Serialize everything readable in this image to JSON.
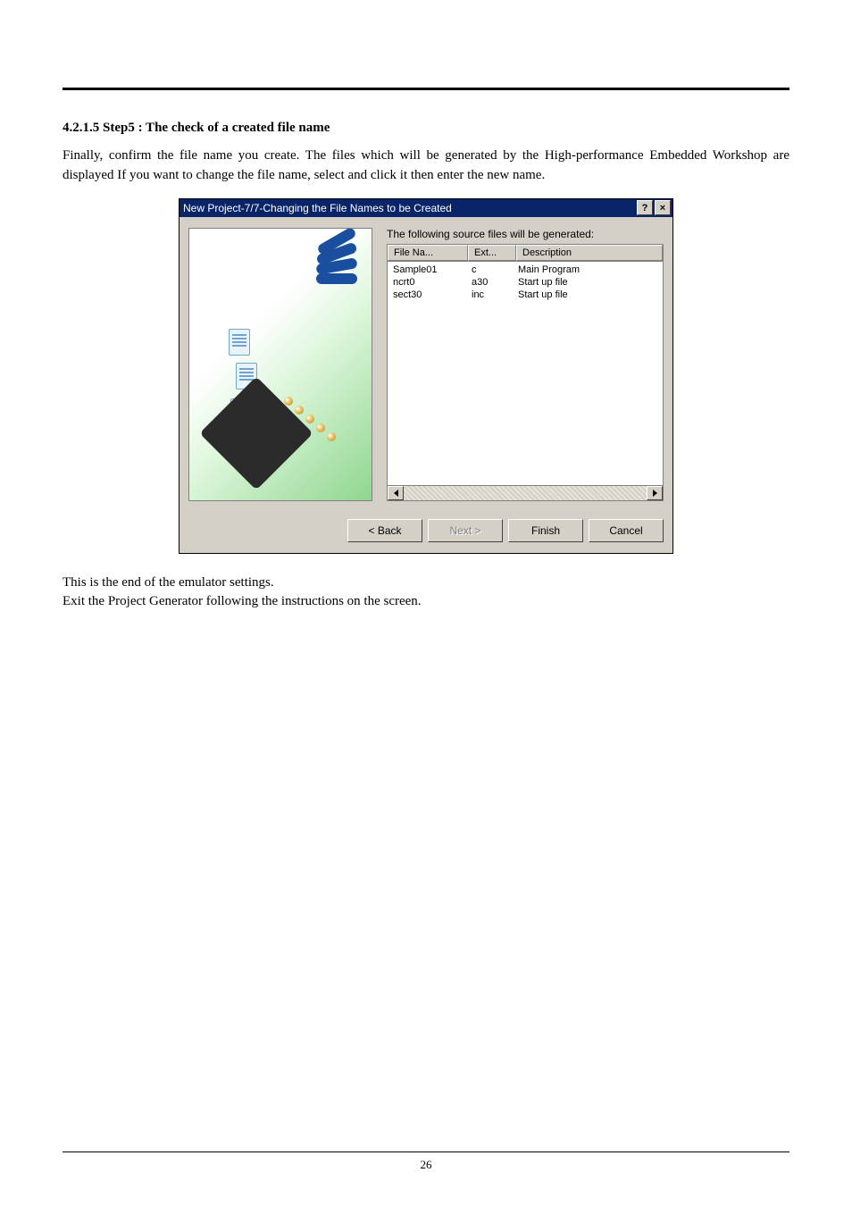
{
  "section": {
    "heading": "4.2.1.5 Step5 : The check of a created file name",
    "para1": "Finally, confirm the file name you create. The files which will be generated by the High-performance Embedded Workshop are displayed If you want to change the file name, select and click it then enter the new name.",
    "para2a": "This is the end of the emulator settings.",
    "para2b": "Exit the Project Generator following the instructions on the screen."
  },
  "dialog": {
    "title": "New Project-7/7-Changing the File Names to be Created",
    "help_symbol": "?",
    "close_symbol": "×",
    "caption": "The following source files will be generated:",
    "headers": {
      "c1": "File Na...",
      "c2": "Ext...",
      "c3": "Description"
    },
    "rows": [
      {
        "c1": "Sample01",
        "c2": "c",
        "c3": "Main Program"
      },
      {
        "c1": "ncrt0",
        "c2": "a30",
        "c3": "Start up file"
      },
      {
        "c1": "sect30",
        "c2": "inc",
        "c3": "Start up file"
      }
    ],
    "buttons": {
      "back": "< Back",
      "next": "Next >",
      "finish": "Finish",
      "cancel": "Cancel"
    }
  },
  "pagenum": "26"
}
